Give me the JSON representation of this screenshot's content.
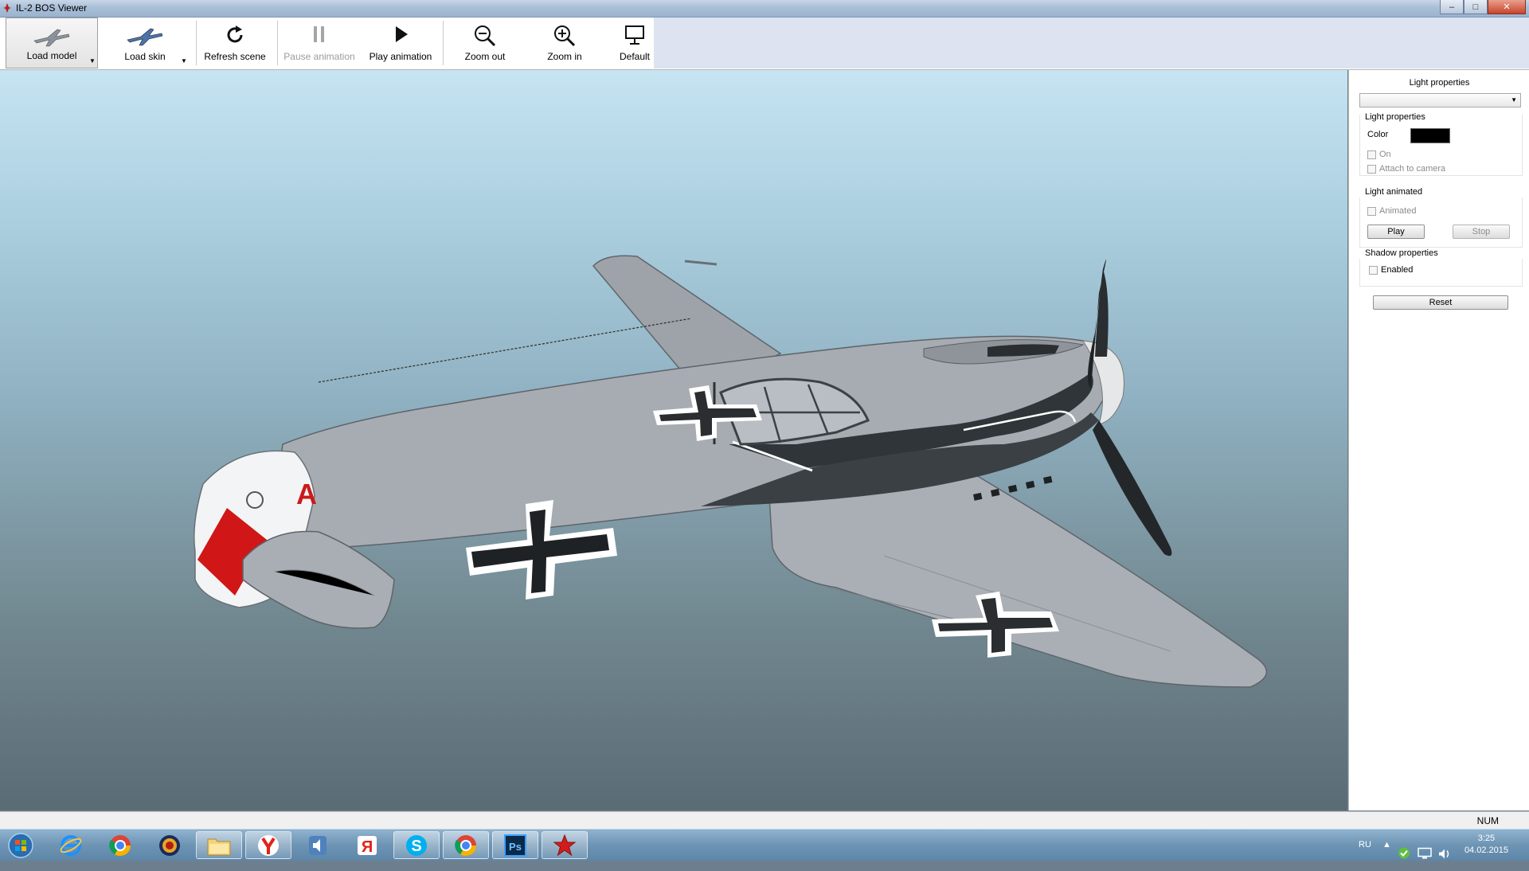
{
  "window": {
    "title": "IL-2 BOS Viewer",
    "controls": [
      "minimize-icon",
      "maximize-icon",
      "close-icon"
    ]
  },
  "toolbar": {
    "buttons": [
      {
        "label": "Load model",
        "icon": "plane-icon",
        "state": "pressed",
        "dropdown": true
      },
      {
        "label": "Load skin",
        "icon": "plane-skin-icon",
        "dropdown": true
      },
      {
        "label": "Refresh scene",
        "icon": "refresh-icon"
      },
      {
        "label": "Pause animation",
        "icon": "pause-icon",
        "state": "disabled"
      },
      {
        "label": "Play animation",
        "icon": "play-icon"
      },
      {
        "label": "Zoom out",
        "icon": "zoom-out-icon"
      },
      {
        "label": "Zoom in",
        "icon": "zoom-in-icon"
      },
      {
        "label": "Default",
        "icon": "monitor-icon"
      }
    ]
  },
  "viewport": {
    "content": "3d-aircraft-model",
    "tail_letter": "A"
  },
  "panel": {
    "title": "Light properties",
    "selector_value": "",
    "light_group": {
      "label": "Light properties",
      "color_label": "Color",
      "color_value": "#000000",
      "on_label": "On",
      "attach_label": "Attach to camera"
    },
    "animated_group": {
      "label": "Light animated",
      "animated_label": "Animated",
      "play_label": "Play",
      "stop_label": "Stop"
    },
    "shadow_group": {
      "label": "Shadow properties",
      "enabled_label": "Enabled"
    },
    "reset_label": "Reset"
  },
  "statusbar": {
    "num_indicator": "NUM"
  },
  "taskbar": {
    "apps": [
      "start-orb-icon",
      "internet-explorer-icon",
      "chrome-icon",
      "target-icon",
      "file-explorer-icon",
      "yandex-browser-icon",
      "speaker-app-icon",
      "yandex-icon",
      "skype-icon",
      "chrome-icon",
      "photoshop-icon",
      "il2-star-icon"
    ],
    "photoshop_label": "Ps",
    "yandex_label": "Я",
    "skype_label": "S",
    "language": "RU",
    "time": "3:25",
    "date": "04.02.2015"
  }
}
